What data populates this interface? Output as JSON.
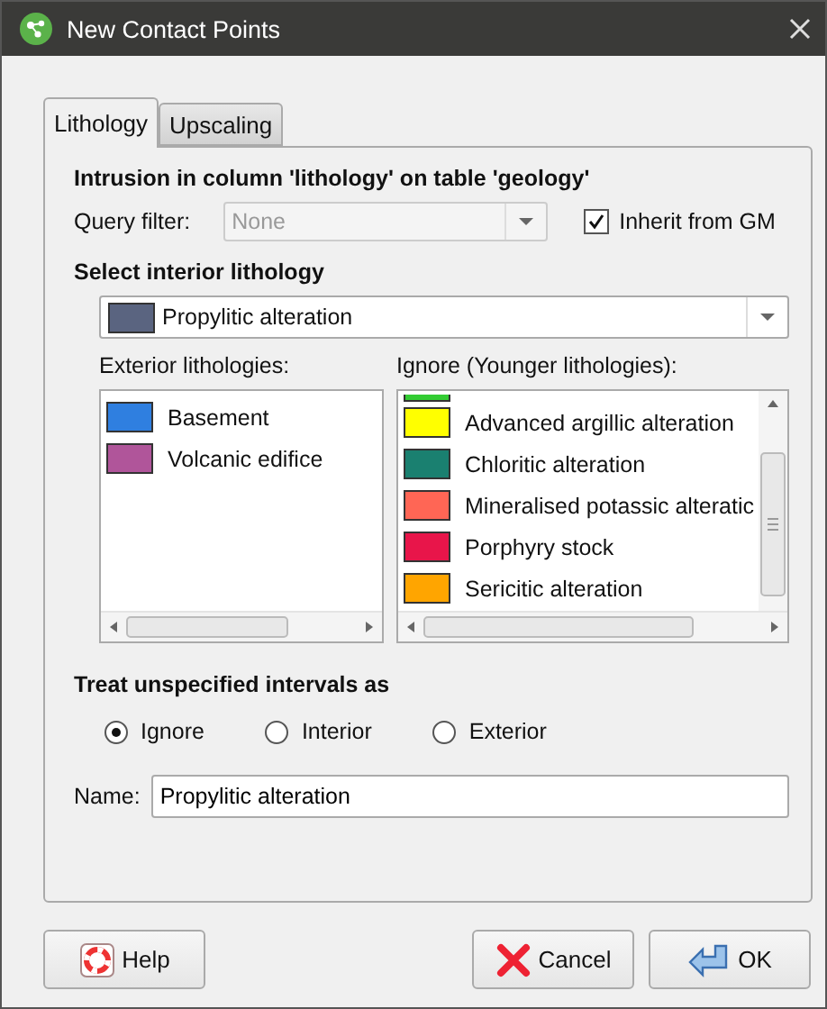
{
  "window": {
    "title": "New Contact Points"
  },
  "tabs": [
    {
      "label": "Lithology",
      "selected": true
    },
    {
      "label": "Upscaling",
      "selected": false
    }
  ],
  "heading": "Intrusion in column 'lithology' on table 'geology'",
  "query_filter": {
    "label": "Query filter:",
    "value": "None",
    "disabled": true
  },
  "inherit": {
    "label": "Inherit from GM",
    "checked": true
  },
  "interior": {
    "label": "Select interior lithology",
    "value": "Propylitic alteration",
    "color": "#5a6480"
  },
  "exterior": {
    "label": "Exterior lithologies:",
    "items": [
      {
        "name": "Basement",
        "color": "#2f7fe0"
      },
      {
        "name": "Volcanic edifice",
        "color": "#b0559a"
      }
    ]
  },
  "ignore": {
    "label": "Ignore (Younger lithologies):",
    "items": [
      {
        "color": "#33cc33"
      },
      {
        "name": "Advanced argillic alteration",
        "color": "#ffff00"
      },
      {
        "name": "Chloritic alteration",
        "color": "#1a8070"
      },
      {
        "name": "Mineralised potassic alteratic",
        "color": "#ff6655"
      },
      {
        "name": "Porphyry stock",
        "color": "#e8154a"
      },
      {
        "name": "Sericitic alteration",
        "color": "#ffa500"
      }
    ]
  },
  "treat": {
    "label": "Treat unspecified intervals as",
    "options": [
      {
        "label": "Ignore",
        "selected": true
      },
      {
        "label": "Interior",
        "selected": false
      },
      {
        "label": "Exterior",
        "selected": false
      }
    ]
  },
  "name": {
    "label": "Name:",
    "value": "Propylitic alteration"
  },
  "buttons": [
    {
      "kind": "help",
      "label": "Help"
    },
    {
      "kind": "cancel",
      "label": "Cancel"
    },
    {
      "kind": "ok",
      "label": "OK"
    }
  ]
}
